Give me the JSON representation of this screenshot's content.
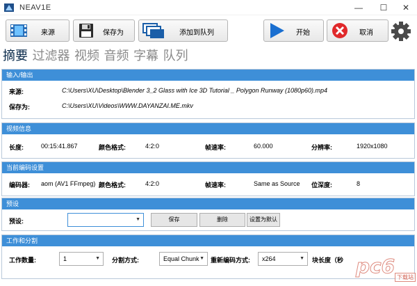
{
  "window": {
    "title": "NEAV1E",
    "min_glyph": "—",
    "max_glyph": "☐",
    "close_glyph": "✕"
  },
  "toolbar": {
    "source_label": "来源",
    "saveas_label": "保存为",
    "add_queue_label": "添加到队列",
    "start_label": "开始",
    "cancel_label": "取消"
  },
  "tabs": [
    {
      "label": "摘要",
      "active": true
    },
    {
      "label": "过滤器"
    },
    {
      "label": "视频"
    },
    {
      "label": "音频"
    },
    {
      "label": "字幕"
    },
    {
      "label": "队列"
    }
  ],
  "io": {
    "header": "输入/输出",
    "source_label": "来源:",
    "source_value": "C:\\Users\\XU\\Desktop\\Blender 3_2 Glass with Ice 3D Tutorial _ Polygon Runway (1080p60).mp4",
    "saveas_label": "保存为:",
    "saveas_value": "C:\\Users\\XU\\Videos\\WWW.DAYANZAI.ME.mkv"
  },
  "video_info": {
    "header": "视频信息",
    "length_label": "长度:",
    "length_value": "00:15:41.867",
    "color_label": "颜色格式:",
    "color_value": "4:2:0",
    "fps_label": "帧速率:",
    "fps_value": "60.000",
    "res_label": "分辨率:",
    "res_value": "1920x1080"
  },
  "encoding": {
    "header": "当前编码设置",
    "encoder_label": "编码器:",
    "encoder_value": "aom (AV1 FFmpeg)",
    "color_label": "颜色格式:",
    "color_value": "4:2:0",
    "fps_label": "帧速率:",
    "fps_value": "Same as Source",
    "depth_label": "位深度:",
    "depth_value": "8"
  },
  "preset": {
    "header": "预设",
    "preset_label": "预设:",
    "preset_value": "",
    "save_label": "保存",
    "delete_label": "删除",
    "default_label": "设置为默认"
  },
  "work": {
    "header": "工作和分割",
    "workers_label": "工作数量:",
    "workers_value": "1",
    "split_label": "分割方式:",
    "split_value": "Equal Chunk",
    "reencode_label": "重新编码方式:",
    "reencode_value": "x264",
    "chunk_label": "块长度（秒"
  },
  "watermark": {
    "text": "pc6",
    "sub": "下载站"
  },
  "colors": {
    "section_header": "#3e8fd8",
    "play_blue": "#1a6fd0",
    "cancel_red": "#e0292b"
  }
}
